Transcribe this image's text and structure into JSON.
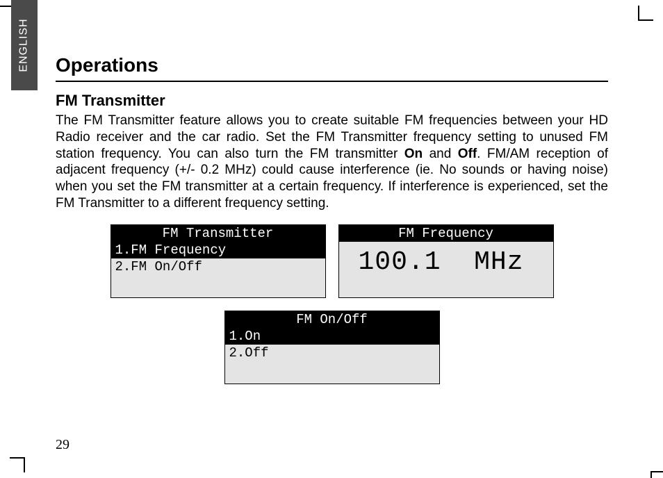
{
  "language_tab": "ENGLISH",
  "page_number": "29",
  "headings": {
    "h1": "Operations",
    "h2": "FM Transmitter"
  },
  "paragraph": {
    "pre": "The FM Transmitter feature allows you to create suitable FM frequencies between your HD Radio receiver and the car radio. Set the FM Transmitter frequency setting to unused FM station frequency. You can also turn the FM transmitter ",
    "bold1": "On",
    "mid": " and ",
    "bold2": "Off",
    "post": ". FM/AM reception of adjacent frequency (+/- 0.2 MHz) could cause interference (ie. No sounds or having noise) when you set the FM transmitter at a certain frequency. If interference is experienced, set the FM Transmitter to a different frequency setting."
  },
  "dialogs": {
    "transmitter": {
      "title": "FM Transmitter",
      "item1": "1.FM Frequency",
      "item2": "2.FM On/Off"
    },
    "frequency": {
      "title": "FM Frequency",
      "value": "100.1  MHz"
    },
    "onoff": {
      "title": "FM On/Off",
      "item1": "1.On",
      "item2": "2.Off"
    }
  }
}
